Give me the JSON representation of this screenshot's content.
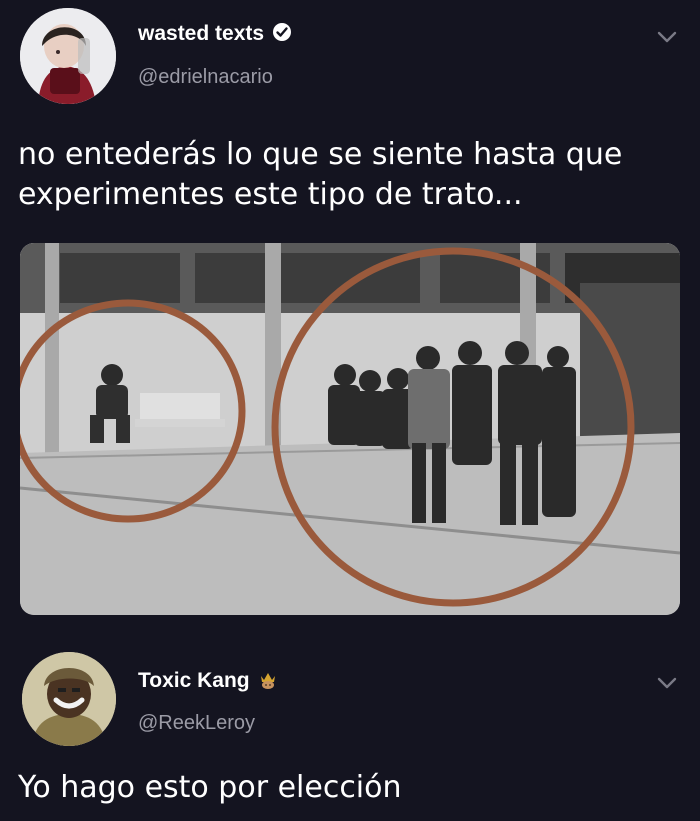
{
  "tweets": [
    {
      "user": {
        "name": "wasted texts",
        "handle": "@edrielnacario",
        "badge": "verified-icon"
      },
      "text": "no entederás lo que se siente hasta que experimentes este tipo de trato...",
      "media": {
        "type": "photo",
        "description_icon": "photo-icon"
      }
    },
    {
      "user": {
        "name": "Toxic Kang",
        "handle": "@ReekLeroy",
        "badge": "crown-emoji-icon"
      },
      "text": "Yo hago esto por elección"
    }
  ],
  "colors": {
    "background": "#141420",
    "text": "#ffffff",
    "handle": "#9b9ba6",
    "circle": "#9a5a3c"
  }
}
